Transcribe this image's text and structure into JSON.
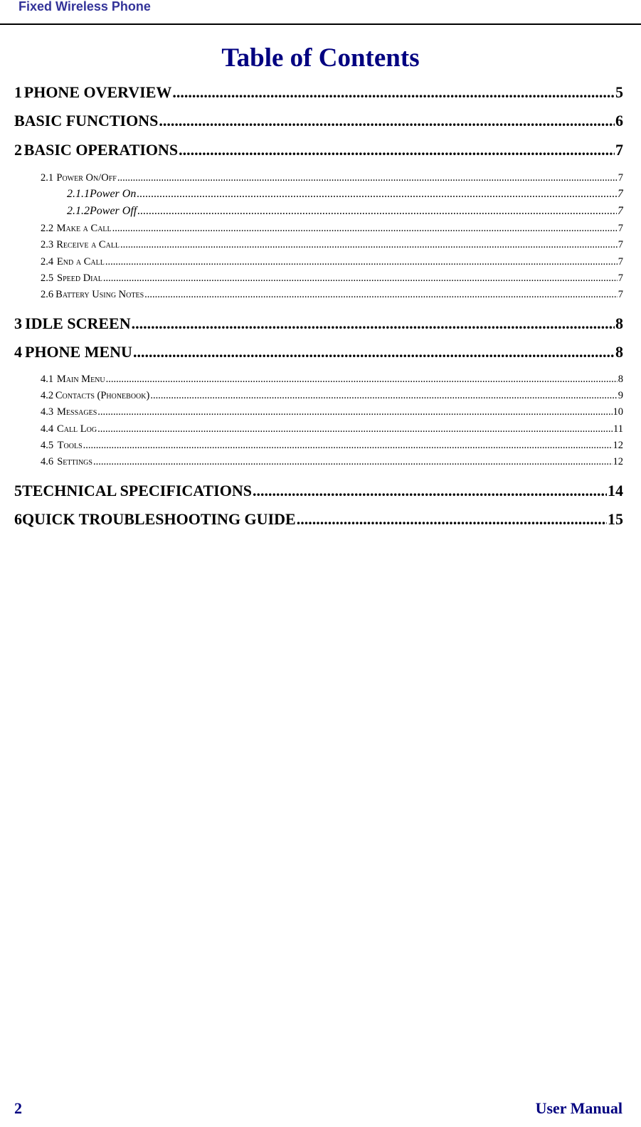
{
  "header": {
    "title": "Fixed Wireless Phone"
  },
  "toc": {
    "title": "Table of Contents",
    "entries": [
      {
        "level": 1,
        "num": "1",
        "label": "PHONE OVERVIEW",
        "page": "5"
      },
      {
        "level": 1,
        "num": "",
        "label": "BASIC FUNCTIONS",
        "page": "6"
      },
      {
        "level": 1,
        "num": "2",
        "label": "BASIC OPERATIONS",
        "page": "7"
      },
      {
        "level": 2,
        "num": "2.1",
        "label": "Power On/Off",
        "page": "7"
      },
      {
        "level": 3,
        "num": "2.1.1",
        "label": "Power On",
        "page": "7"
      },
      {
        "level": 3,
        "num": "2.1.2",
        "label": "Power Off",
        "page": "7"
      },
      {
        "level": 2,
        "num": "2.2",
        "label": "Make a Call",
        "page": "7"
      },
      {
        "level": 2,
        "num": "2.3",
        "label": "Receive a Call",
        "page": "7"
      },
      {
        "level": 2,
        "num": "2.4",
        "label": "End a Call",
        "page": "7"
      },
      {
        "level": 2,
        "num": "2.5",
        "label": "Speed Dial",
        "page": "7"
      },
      {
        "level": 2,
        "num": "2.6",
        "label": "Battery Using Notes",
        "page": "7"
      },
      {
        "level": 1,
        "num": "3",
        "label": "IDLE SCREEN",
        "page": "8"
      },
      {
        "level": 1,
        "num": "4",
        "label": "PHONE MENU",
        "page": "8"
      },
      {
        "level": 2,
        "num": "4.1",
        "label": "Main Menu",
        "page": "8"
      },
      {
        "level": 2,
        "num": "4.2",
        "label": "Contacts (Phonebook)",
        "page": "9"
      },
      {
        "level": 2,
        "num": "4.3",
        "label": "Messages",
        "page": "10"
      },
      {
        "level": 2,
        "num": "4.4",
        "label": "Call Log",
        "page": "11"
      },
      {
        "level": 2,
        "num": "4.5",
        "label": "Tools",
        "page": "12"
      },
      {
        "level": 2,
        "num": "4.6",
        "label": "Settings",
        "page": "12"
      },
      {
        "level": 1,
        "num": "5",
        "label": "TECHNICAL SPECIFICATIONS",
        "page": "14"
      },
      {
        "level": 1,
        "num": "6",
        "label": "QUICK TROUBLESHOOTING GUIDE",
        "page": "15"
      }
    ]
  },
  "footer": {
    "page_number": "2",
    "title": "User Manual"
  }
}
